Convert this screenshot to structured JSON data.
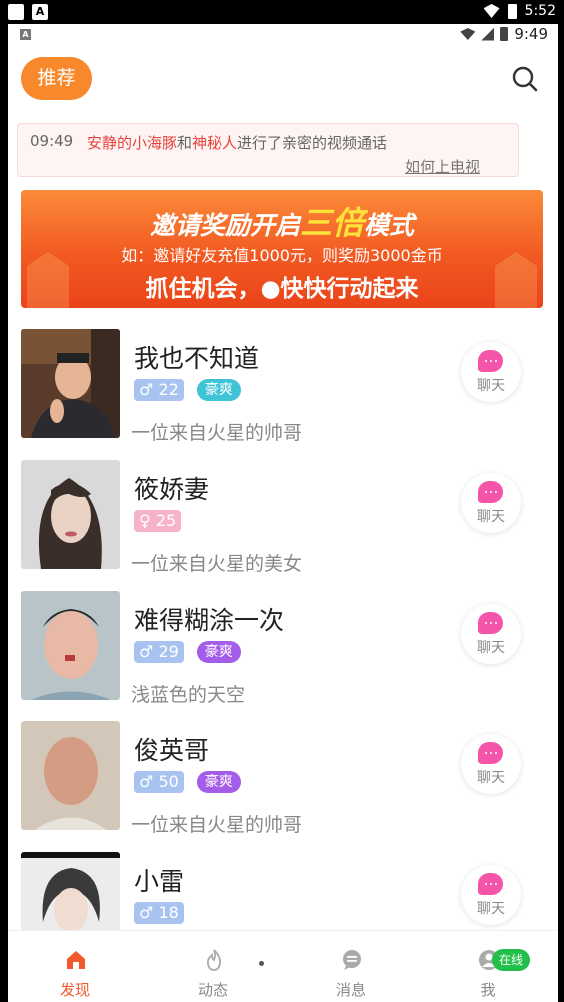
{
  "system_status": {
    "time": "5:52"
  },
  "status_bar": {
    "time": "9:49"
  },
  "header": {
    "recommend_tab": "推荐"
  },
  "notice": {
    "time": "09:49",
    "user1": "安静的小海豚",
    "and": "和",
    "user2": "神秘人",
    "text": "进行了亲密的视频通话",
    "link": "如何上电视"
  },
  "banner": {
    "title_prefix": "邀请奖励开启",
    "title_highlight": "三倍",
    "title_suffix": "模式",
    "subtitle": "如：邀请好友充值1000元，则奖励3000金币",
    "cta": "抓住机会，●快快行动起来"
  },
  "users": [
    {
      "name": "我也不知道",
      "gender_icon": "♂",
      "gender": "m",
      "age": "22",
      "vip": "豪爽",
      "vip_color": "#3fc3d6",
      "bio": "一位来自火星的帅哥",
      "chat": "聊天"
    },
    {
      "name": "筱娇妻",
      "gender_icon": "♀",
      "gender": "f",
      "age": "25",
      "vip": "",
      "vip_color": "",
      "bio": "一位来自火星的美女",
      "chat": "聊天"
    },
    {
      "name": "难得糊涂一次",
      "gender_icon": "♂",
      "gender": "m",
      "age": "29",
      "vip": "豪爽",
      "vip_color": "#a45de8",
      "bio": "浅蓝色的天空",
      "chat": "聊天"
    },
    {
      "name": "俊英哥",
      "gender_icon": "♂",
      "gender": "m",
      "age": "50",
      "vip": "豪爽",
      "vip_color": "#a45de8",
      "bio": "一位来自火星的帅哥",
      "chat": "聊天"
    },
    {
      "name": "小雷",
      "gender_icon": "♂",
      "gender": "m",
      "age": "18",
      "vip": "",
      "vip_color": "",
      "bio": "",
      "chat": "聊天"
    }
  ],
  "bottom_nav": {
    "discover": "发现",
    "moments": "动态",
    "messages": "消息",
    "me": "我",
    "online_badge": "在线"
  },
  "colors": {
    "accent": "#f7882b",
    "chat_pink": "#f455a8",
    "online_green": "#22c04a"
  }
}
